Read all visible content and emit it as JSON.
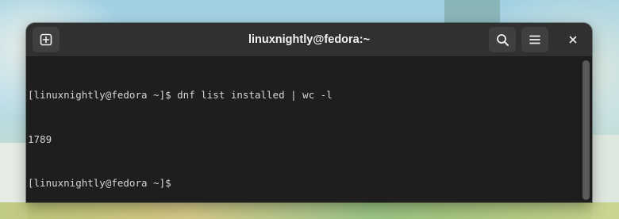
{
  "window": {
    "title": "linuxnightly@fedora:~"
  },
  "headerbar": {
    "new_tab_icon": "new-tab-icon",
    "search_icon": "search-icon",
    "menu_icon": "hamburger-menu-icon",
    "close_icon": "close-icon"
  },
  "terminal": {
    "lines": [
      "[linuxnightly@fedora ~]$ dnf list installed | wc -l",
      "1789",
      "[linuxnightly@fedora ~]$"
    ]
  },
  "colors": {
    "terminal_bg": "#1e1e1e",
    "headerbar_bg": "#303030",
    "button_bg": "#3f3f3f",
    "text": "#d6d6d6"
  }
}
